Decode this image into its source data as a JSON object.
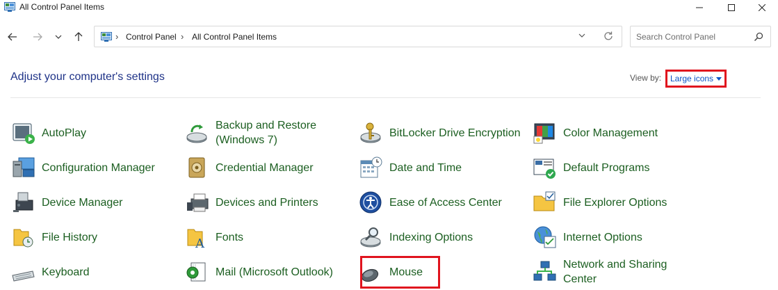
{
  "window": {
    "title": "All Control Panel Items",
    "controls": [
      "minimize-icon",
      "maximize-icon",
      "close-icon"
    ]
  },
  "nav": {
    "buttons": [
      "back-arrow-icon",
      "forward-arrow-icon",
      "recent-chevron-icon",
      "up-arrow-icon"
    ]
  },
  "address": {
    "crumbs": [
      "Control Panel",
      "All Control Panel Items"
    ]
  },
  "search": {
    "placeholder": "Search Control Panel"
  },
  "main": {
    "heading": "Adjust your computer's settings",
    "view_by_label": "View by:",
    "view_by_value": "Large icons"
  },
  "items": [
    {
      "label": "AutoPlay",
      "icon": "autoplay-icon"
    },
    {
      "label": "Backup and Restore (Windows 7)",
      "icon": "backup-restore-icon"
    },
    {
      "label": "BitLocker Drive Encryption",
      "icon": "bitlocker-icon"
    },
    {
      "label": "Color Management",
      "icon": "color-management-icon"
    },
    {
      "label": "Configuration Manager",
      "icon": "configuration-manager-icon"
    },
    {
      "label": "Credential Manager",
      "icon": "credential-manager-icon"
    },
    {
      "label": "Date and Time",
      "icon": "date-time-icon"
    },
    {
      "label": "Default Programs",
      "icon": "default-programs-icon"
    },
    {
      "label": "Device Manager",
      "icon": "device-manager-icon"
    },
    {
      "label": "Devices and Printers",
      "icon": "devices-printers-icon"
    },
    {
      "label": "Ease of Access Center",
      "icon": "ease-of-access-icon"
    },
    {
      "label": "File Explorer Options",
      "icon": "file-explorer-options-icon"
    },
    {
      "label": "File History",
      "icon": "file-history-icon"
    },
    {
      "label": "Fonts",
      "icon": "fonts-icon"
    },
    {
      "label": "Indexing Options",
      "icon": "indexing-options-icon"
    },
    {
      "label": "Internet Options",
      "icon": "internet-options-icon"
    },
    {
      "label": "Keyboard",
      "icon": "keyboard-icon"
    },
    {
      "label": "Mail (Microsoft Outlook)",
      "icon": "mail-icon"
    },
    {
      "label": "Mouse",
      "icon": "mouse-icon"
    },
    {
      "label": "Network and Sharing Center",
      "icon": "network-sharing-icon"
    }
  ],
  "colors": {
    "link_green": "#1b5e20",
    "heading_blue": "#1e3287",
    "accent_blue": "#0b53c6",
    "highlight_red": "#e0141e"
  }
}
